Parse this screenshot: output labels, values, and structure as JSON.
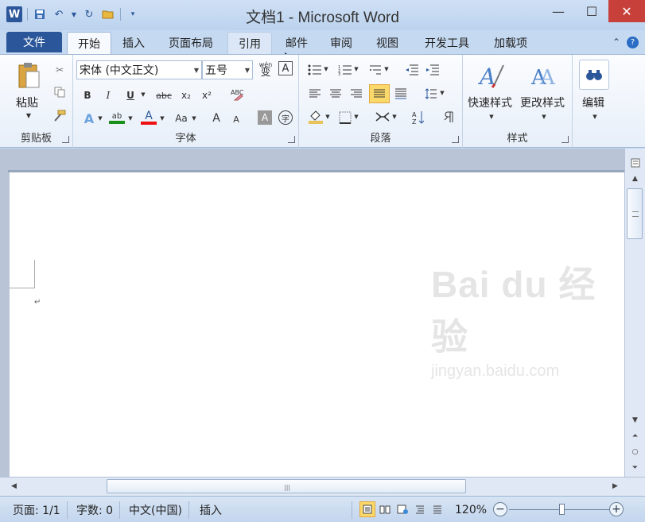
{
  "window": {
    "title": "文档1 - Microsoft Word",
    "logo": "W",
    "controls": {
      "minimize": "—",
      "maximize": "☐",
      "close": "✕"
    }
  },
  "qat": {
    "save_icon": "save-icon",
    "undo_icon": "undo-icon",
    "redo_icon": "redo-icon",
    "open_icon": "folder-icon"
  },
  "tabs": {
    "file": "文件",
    "items": [
      "开始",
      "插入",
      "页面布局",
      "引用",
      "邮件",
      "审阅",
      "视图",
      "开发工具",
      "加载项"
    ]
  },
  "ribbon": {
    "clipboard": {
      "label": "剪贴板",
      "paste": "粘贴"
    },
    "font": {
      "label": "字体",
      "font_name": "宋体 (中文正文)",
      "font_size": "五号",
      "bold": "B",
      "italic": "I",
      "underline": "U",
      "strike": "abc",
      "sub": "x₂",
      "sup": "x²",
      "grow": "A",
      "shrink": "A",
      "change_case": "Aa",
      "wen": "wén",
      "phonetic_char": "变",
      "border_char": "A",
      "circle_char": "字"
    },
    "paragraph": {
      "label": "段落"
    },
    "styles": {
      "label": "样式",
      "quick_styles": "快速样式",
      "change_styles": "更改样式"
    },
    "editing": {
      "label": "编辑"
    }
  },
  "status": {
    "page": "页面: 1/1",
    "words": "字数: 0",
    "language": "中文(中国)",
    "mode": "插入",
    "zoom": "120%"
  },
  "watermark": {
    "main": "Bai du 经验",
    "url": "jingyan.baidu.com"
  },
  "colors": {
    "accent": "#2b579a",
    "close": "#c7403a",
    "active_button": "#fbd86a"
  }
}
